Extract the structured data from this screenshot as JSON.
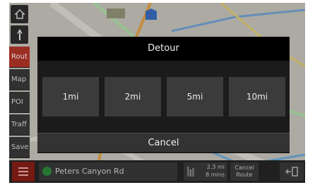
{
  "dialog": {
    "title": "Detour",
    "options": [
      "1mi",
      "2mi",
      "5mi",
      "10mi"
    ],
    "cancel_label": "Cancel"
  },
  "sidebar": {
    "items": [
      "Rout",
      "Map",
      "POI",
      "Traff",
      "Save"
    ],
    "active_index": 0
  },
  "bottom_bar": {
    "street": "Peters Canyon Rd",
    "eta_distance": "2.3 mi",
    "eta_time": "8 mins",
    "cancel_route_line1": "Cancel",
    "cancel_route_line2": "Route"
  },
  "icons": {
    "home": "home-icon",
    "north": "north-arrow-icon",
    "menu": "menu-icon",
    "exit": "exit-icon",
    "route_status": "route-status-icon"
  },
  "colors": {
    "active_red": "#b8352a",
    "menu_red": "#8a1e17",
    "street_dot": "#2e8b3a"
  }
}
